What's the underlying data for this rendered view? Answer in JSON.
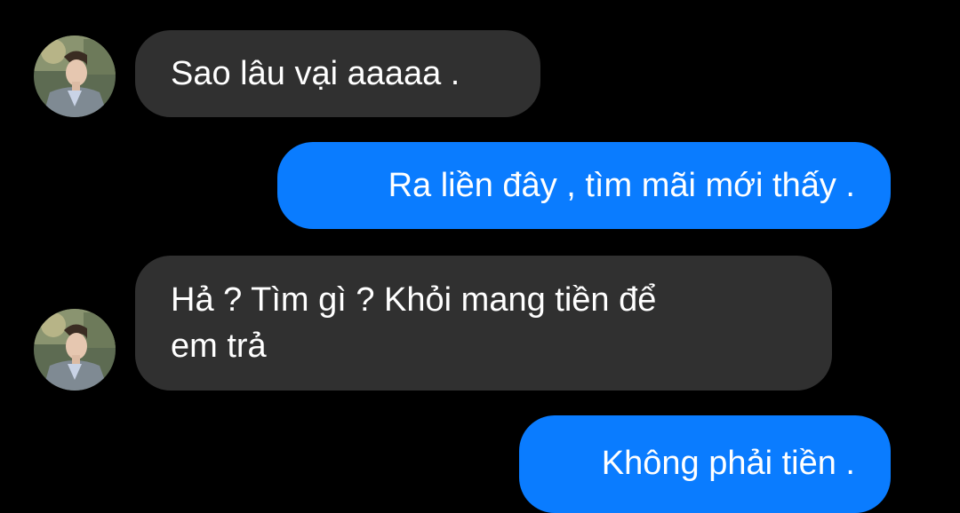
{
  "conversation": {
    "messages": [
      {
        "direction": "incoming",
        "text": "Sao lâu vại aaaaa ."
      },
      {
        "direction": "outgoing",
        "text": "Ra liền đây , tìm mãi mới thấy ."
      },
      {
        "direction": "incoming",
        "text": "Hả ? Tìm gì ? Khỏi mang tiền để\nem trả"
      },
      {
        "direction": "outgoing",
        "text": "Không phải tiền ."
      }
    ]
  },
  "colors": {
    "background": "#000000",
    "incoming_bubble": "#303030",
    "outgoing_bubble": "#0a7cff",
    "text": "#ffffff"
  },
  "icons": {
    "contact_avatar": "profile-photo-avatar"
  }
}
